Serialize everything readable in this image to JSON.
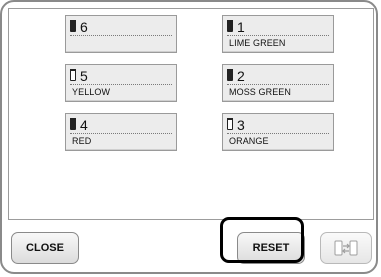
{
  "spools": [
    {
      "number": "6",
      "color_name": "",
      "icon": "spool-filled-icon"
    },
    {
      "number": "1",
      "color_name": "LIME GREEN",
      "icon": "spool-filled-icon"
    },
    {
      "number": "5",
      "color_name": "YELLOW",
      "icon": "spool-empty-icon"
    },
    {
      "number": "2",
      "color_name": "MOSS GREEN",
      "icon": "spool-filled-icon"
    },
    {
      "number": "4",
      "color_name": "RED",
      "icon": "spool-filled-icon"
    },
    {
      "number": "3",
      "color_name": "ORANGE",
      "icon": "spool-empty-icon"
    }
  ],
  "buttons": {
    "close_label": "CLOSE",
    "reset_label": "RESET",
    "swap_icon": "swap-spools-icon"
  },
  "colors": {
    "border": "#8a8a8a",
    "button_bg": "#e6e6e6",
    "highlight": "#000000"
  }
}
